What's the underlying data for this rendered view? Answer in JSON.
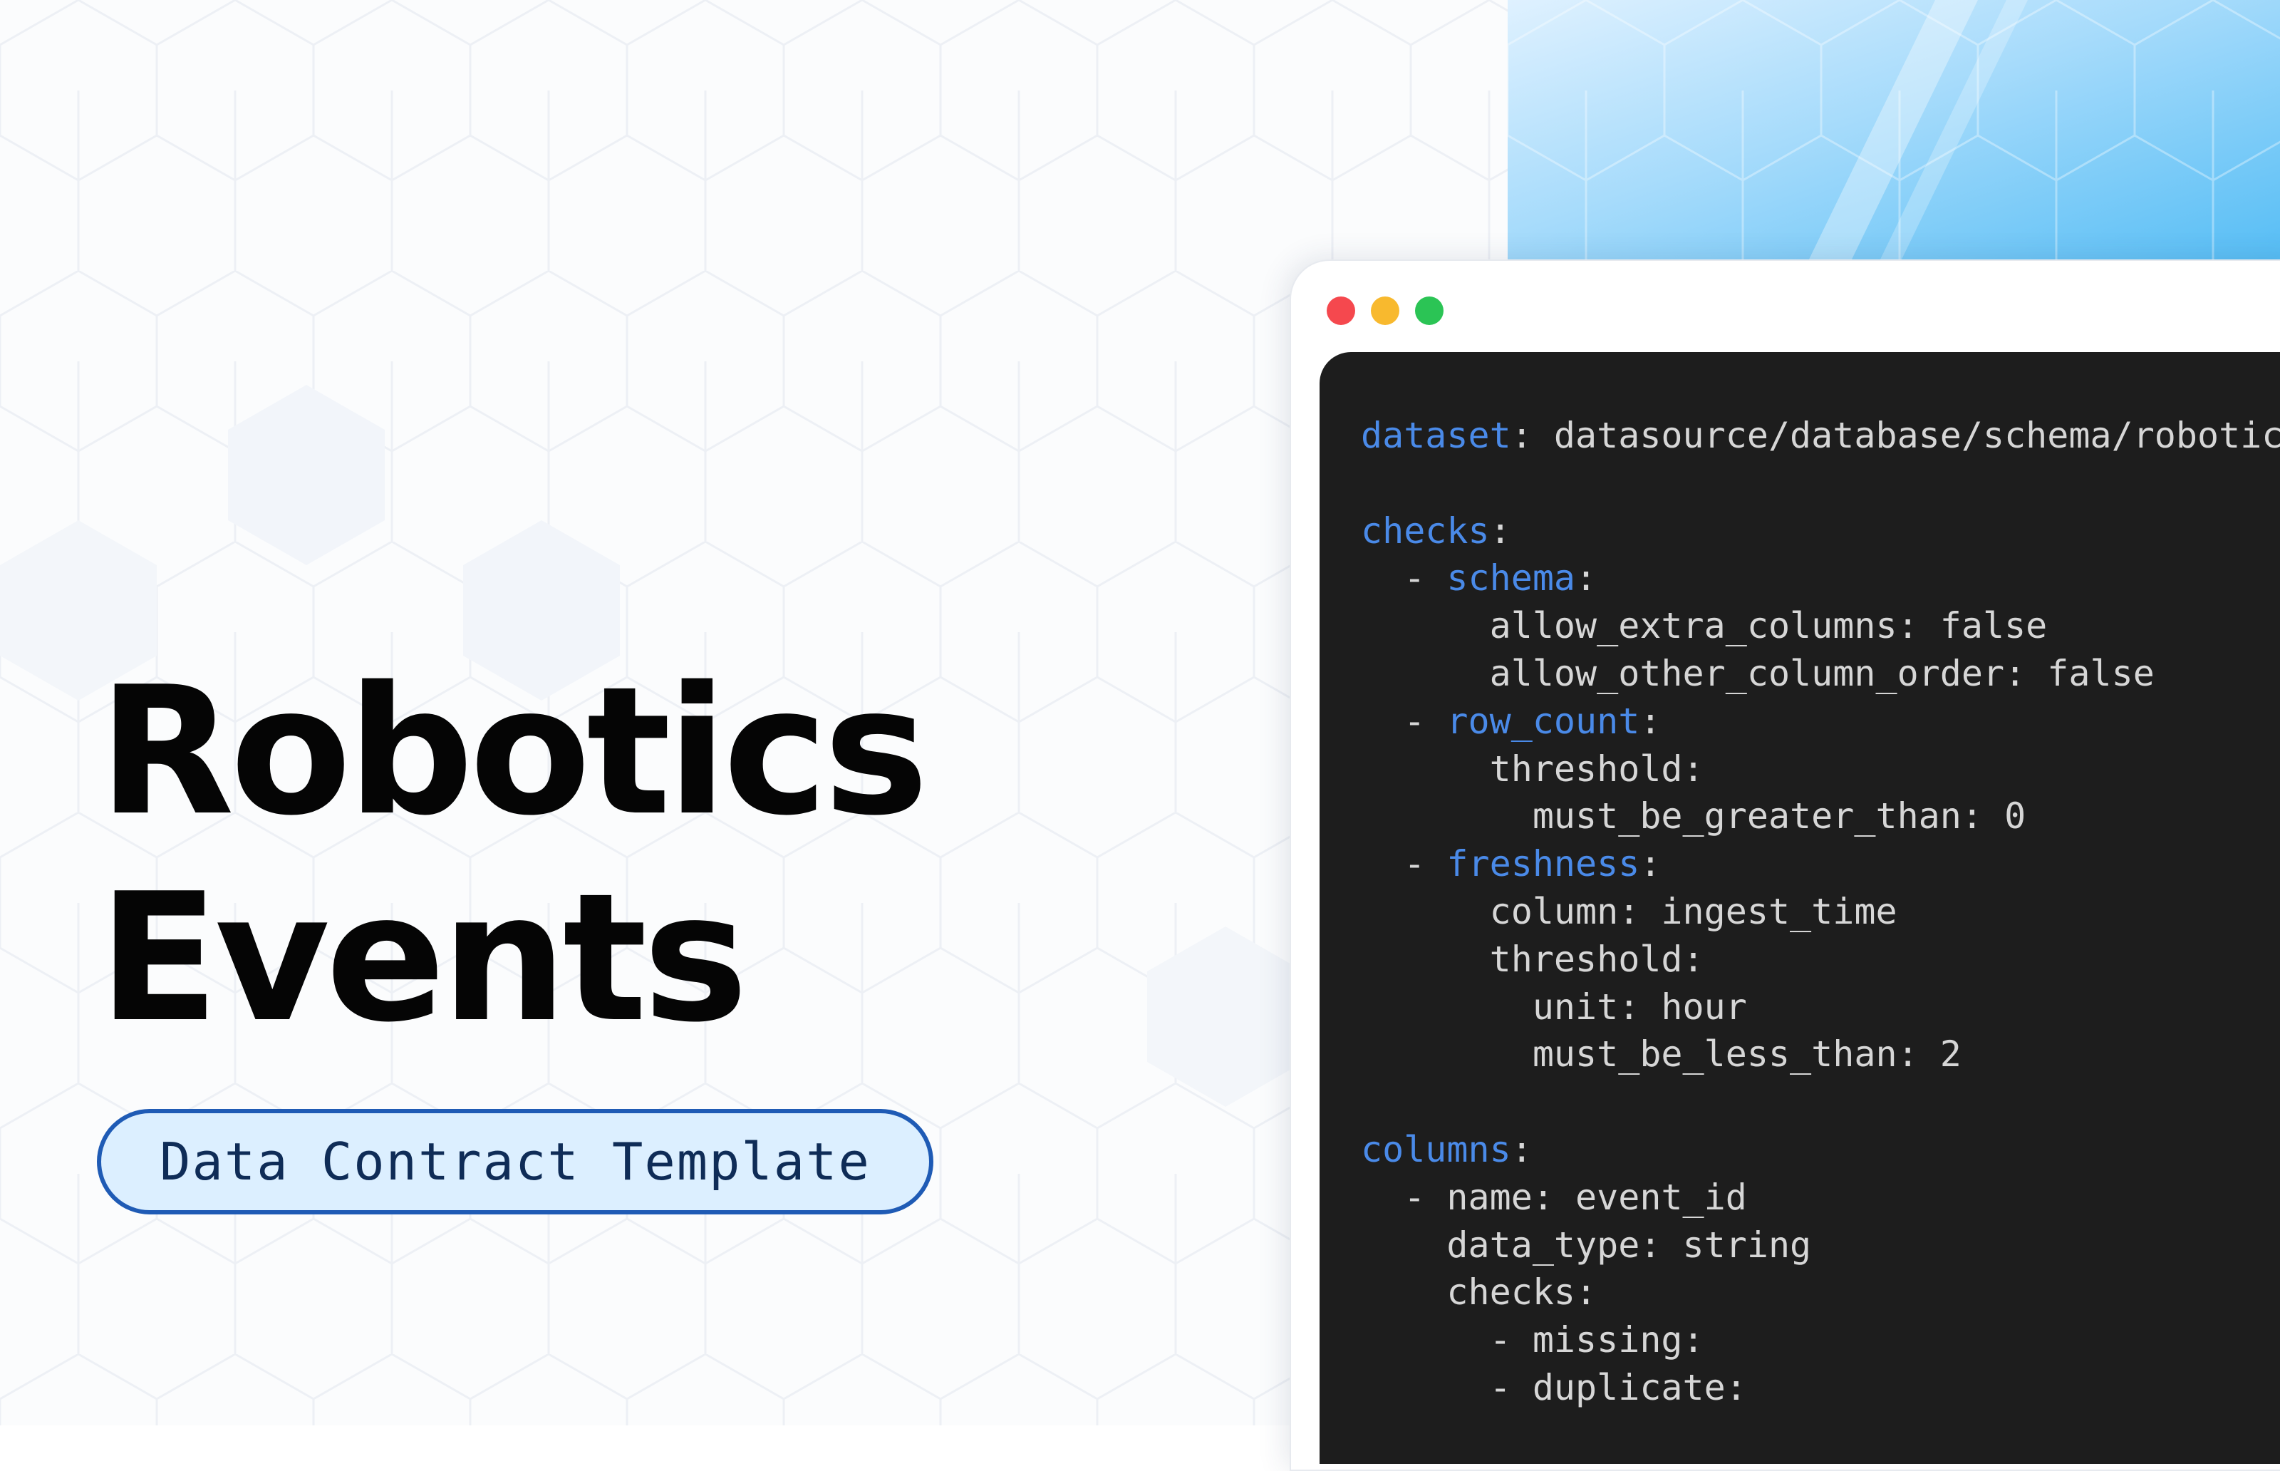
{
  "title_lines": [
    "Robotics",
    "Events"
  ],
  "badge_text": "Data Contract Template",
  "colors": {
    "title": "#050505",
    "badge_border": "#1f5bb5",
    "badge_fill": "#dcefff",
    "badge_text": "#0f2c57",
    "code_background": "#1d1d1d",
    "code_text": "#d6d6d6",
    "code_key": "#4a8ae8",
    "traffic_red": "#f5484e",
    "traffic_yellow": "#f8b92e",
    "traffic_green": "#2bc455"
  },
  "code_lines": [
    {
      "indent": "",
      "key": "dataset",
      "rest": ": datasource/database/schema/robotics_events"
    },
    {
      "indent": "",
      "key": "",
      "rest": ""
    },
    {
      "indent": "",
      "key": "checks",
      "rest": ":"
    },
    {
      "indent": "  - ",
      "key": "schema",
      "rest": ":"
    },
    {
      "indent": "",
      "key": "",
      "rest": "      allow_extra_columns: false"
    },
    {
      "indent": "",
      "key": "",
      "rest": "      allow_other_column_order: false"
    },
    {
      "indent": "  - ",
      "key": "row_count",
      "rest": ":"
    },
    {
      "indent": "",
      "key": "",
      "rest": "      threshold:"
    },
    {
      "indent": "",
      "key": "",
      "rest": "        must_be_greater_than: 0"
    },
    {
      "indent": "  - ",
      "key": "freshness",
      "rest": ":"
    },
    {
      "indent": "",
      "key": "",
      "rest": "      column: ingest_time"
    },
    {
      "indent": "",
      "key": "",
      "rest": "      threshold:"
    },
    {
      "indent": "",
      "key": "",
      "rest": "        unit: hour"
    },
    {
      "indent": "",
      "key": "",
      "rest": "        must_be_less_than: 2"
    },
    {
      "indent": "",
      "key": "",
      "rest": ""
    },
    {
      "indent": "",
      "key": "columns",
      "rest": ":"
    },
    {
      "indent": "",
      "key": "",
      "rest": "  - name: event_id"
    },
    {
      "indent": "",
      "key": "",
      "rest": "    data_type: string"
    },
    {
      "indent": "",
      "key": "",
      "rest": "    checks:"
    },
    {
      "indent": "",
      "key": "",
      "rest": "      - missing:"
    },
    {
      "indent": "",
      "key": "",
      "rest": "      - duplicate:"
    }
  ]
}
